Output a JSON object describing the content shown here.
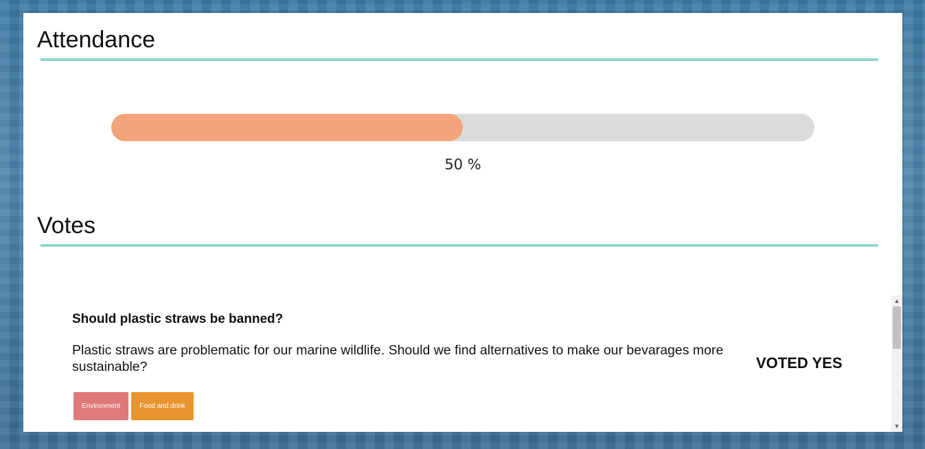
{
  "attendance": {
    "title": "Attendance",
    "progress_fraction": 0.5,
    "progress_label": "50 %",
    "fill_color": "#f3a47a",
    "track_color": "#dbdbdb"
  },
  "votes": {
    "title": "Votes",
    "items": [
      {
        "question": "Should plastic straws be banned?",
        "description": "Plastic straws are problematic for our marine wildlife. Should we find alternatives to make our bevarages more sustainable?",
        "status": "VOTED YES",
        "tags": [
          {
            "label": "Environment",
            "color": "#e07a7a"
          },
          {
            "label": "Food and drink",
            "color": "#e8952f"
          }
        ]
      }
    ]
  },
  "accent_color": "#8fd8cc",
  "scrollbar": {
    "up_icon": "triangle-up-icon",
    "down_icon": "triangle-down-icon"
  }
}
